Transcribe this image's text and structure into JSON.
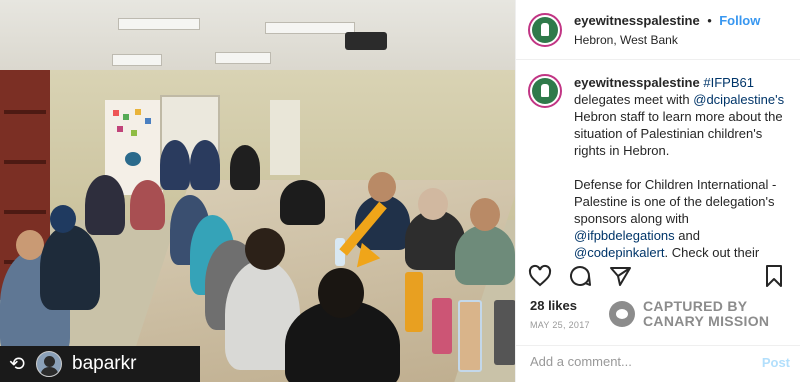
{
  "post": {
    "username": "eyewitnesspalestine",
    "follow_label": "Follow",
    "separator": "•",
    "location": "Hebron, West Bank",
    "caption": {
      "username": "eyewitnesspalestine",
      "hashtag": "#IFPB61",
      "line1_rest": "delegates meet with",
      "mention1": "@dcipalestine's",
      "line1_tail": "Hebron staff to learn more about the situation of Palestinian children's rights in Hebron.",
      "para2_a": "Defense for Children International - Palestine is one of the delegation's sponsors along with",
      "mention2": "@ifpbdelegations",
      "para2_and": "and",
      "mention3": "@codepinkalert",
      "para2_b": ". Check out their excellent work at ▶▶▶ www.dci-"
    },
    "likes": "28 likes",
    "date": "MAY 25, 2017",
    "comment_placeholder": "Add a comment...",
    "post_label": "Post"
  },
  "repost": {
    "username": "baparkr"
  },
  "watermark": {
    "line1": "CAPTURED BY",
    "line2": "CANARY MISSION"
  },
  "icons": {
    "repost": "repost-icon",
    "like": "heart-icon",
    "comment": "comment-icon",
    "share": "share-icon",
    "save": "bookmark-icon"
  },
  "colors": {
    "follow": "#3897f0",
    "avatar_ring": "#c13584",
    "arrow": "#f0a519"
  }
}
